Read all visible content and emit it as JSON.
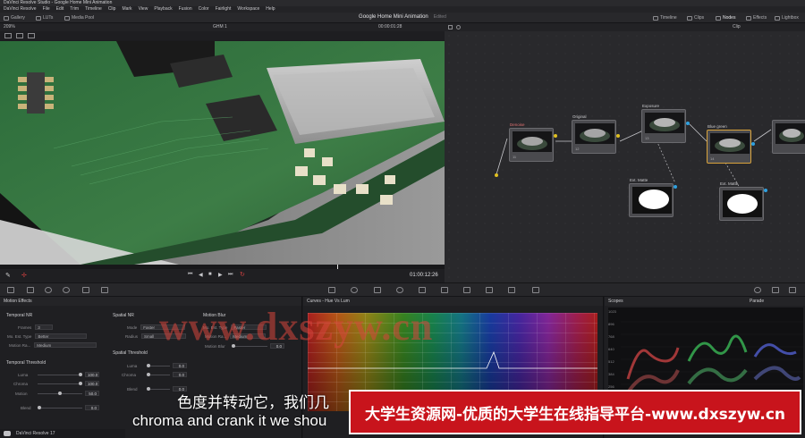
{
  "window": {
    "title": "DaVinci Resolve Studio - Google Home Mini Animation"
  },
  "menu": [
    "DaVinci Resolve",
    "File",
    "Edit",
    "Trim",
    "Timeline",
    "Clip",
    "Mark",
    "View",
    "Playback",
    "Fusion",
    "Color",
    "Fairlight",
    "Workspace",
    "Help"
  ],
  "toolbar": {
    "gallery": "Gallery",
    "luts": "LUTs",
    "media_pool": "Media Pool",
    "project_title": "Google Home Mini Animation",
    "project_state": "Edited",
    "timeline": "Timeline",
    "clips": "Clips",
    "nodes": "Nodes",
    "effects": "Effects",
    "lightbox": "Lightbox"
  },
  "viewer": {
    "zoom": "209%",
    "clip_name": "GHM 1",
    "source_timecode": "00:00:01:28",
    "record_timecode": "01:00:12:26"
  },
  "node_editor": {
    "mode": "Clip",
    "nodes": [
      {
        "id": "denoise",
        "label": "Denoise",
        "number": "11"
      },
      {
        "id": "original",
        "label": "Original",
        "number": "12"
      },
      {
        "id": "exposure",
        "label": "Exposure",
        "number": "13"
      },
      {
        "id": "bluegreen",
        "label": "Blue green",
        "number": "14"
      },
      {
        "id": "extmatte1",
        "label": "Ext. Matte"
      },
      {
        "id": "extmatte2",
        "label": "Ext. Matte"
      }
    ]
  },
  "motion_effects": {
    "title": "Motion Effects",
    "temporal_nr": {
      "heading": "Temporal NR",
      "frames_label": "Frames",
      "frames_value": "3",
      "mo_est_label": "Mo. Est. Type",
      "mo_est_value": "Better",
      "motion_range_label": "Motion Ra...",
      "motion_range_value": "Medium"
    },
    "spatial_nr": {
      "heading": "Spatial NR",
      "mode_label": "Mode",
      "mode_value": "Faster",
      "radius_label": "Radius",
      "radius_value": "Small"
    },
    "motion_blur": {
      "heading": "Motion Blur",
      "mo_est_label": "Mo. Est. Type",
      "mo_est_value": "Faster",
      "motion_range_label": "Motion Ra...",
      "motion_range_value": "Medium",
      "blur_label": "Motion Blur",
      "blur_value": "0.0"
    },
    "temporal_threshold": {
      "heading": "Temporal Threshold",
      "luma_label": "Luma",
      "luma_value": "100.0",
      "chroma_label": "Chroma",
      "chroma_value": "100.0",
      "motion_label": "Motion",
      "motion_value": "50.0",
      "blend_label": "Blend",
      "blend_value": "0.0"
    },
    "spatial_threshold": {
      "heading": "Spatial Threshold",
      "luma_label": "Luma",
      "luma_value": "0.0",
      "chroma_label": "Chroma",
      "chroma_value": "0.0",
      "blend_label": "Blend",
      "blend_value": "0.0"
    }
  },
  "curves": {
    "title": "Curves - Hue Vs Lum"
  },
  "scopes": {
    "title": "Scopes",
    "mode": "Parade",
    "scale": [
      "1023",
      "896",
      "768",
      "640",
      "512",
      "384",
      "256",
      "128",
      "0"
    ]
  },
  "status": {
    "app": "DaVinci Resolve 17"
  },
  "overlay": {
    "watermark": "www.dxszyw.cn",
    "subtitle_cn": "色度并转动它，我们几",
    "subtitle_en": "chroma and crank it we shou",
    "banner": "大学生资源网-优质的大学生在线指导平台-www.dxszyw.cn"
  },
  "colors": {
    "accent": "#d8a23b",
    "banner_red": "#c8141c",
    "selected_pin": "#e0c020"
  }
}
